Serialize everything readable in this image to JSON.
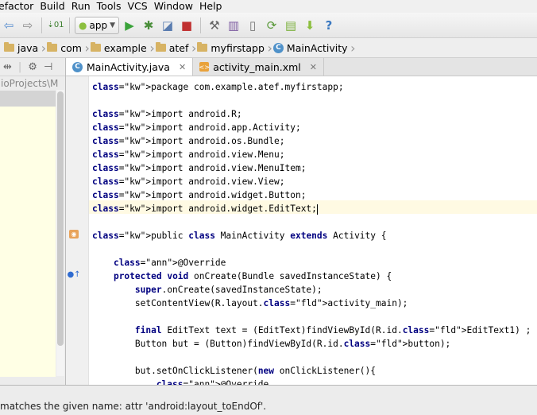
{
  "menu": [
    "efactor",
    "Build",
    "Run",
    "Tools",
    "VCS",
    "Window",
    "Help"
  ],
  "toolbar": {
    "run_config": "app",
    "icons": [
      "undo-icon",
      "redo-icon",
      "sort-icon",
      "android-icon",
      "run-icon",
      "debug-icon",
      "attach-debugger-icon",
      "stop-icon",
      "project-structure-icon",
      "sdk-settings-icon",
      "avd-manager-icon",
      "sync-gradle-icon",
      "android-device-monitor-icon",
      "sdk-manager-icon",
      "help-icon"
    ]
  },
  "breadcrumbs": [
    "java",
    "com",
    "example",
    "atef",
    "myfirstapp",
    "MainActivity"
  ],
  "sidebar": {
    "path_text": "ioProjects\\M"
  },
  "tabs": [
    {
      "label": "MainActivity.java",
      "active": true
    },
    {
      "label": "activity_main.xml",
      "active": false
    }
  ],
  "code_lines": [
    "package com.example.atef.myfirstapp;",
    "",
    "import android.R;",
    "import android.app.Activity;",
    "import android.os.Bundle;",
    "import android.view.Menu;",
    "import android.view.MenuItem;",
    "import android.view.View;",
    "import android.widget.Button;",
    "import android.widget.EditText;",
    "",
    "public class MainActivity extends Activity {",
    "",
    "    @Override",
    "    protected void onCreate(Bundle savedInstanceState) {",
    "        super.onCreate(savedInstanceState);",
    "        setContentView(R.layout.activity_main);",
    "",
    "        final EditText text = (EditText)findViewById(R.id.EditText1) ;",
    "        Button but = (Button)findViewById(R.id.button);",
    "",
    "        but.setOnClickListener(new onClickListener(){",
    "            @Override"
  ],
  "status": {
    "message": "matches the given name: attr 'android:layout_toEndOf'."
  },
  "colors": {
    "current_line": "#fffae3",
    "keyword": "#000080",
    "annotation": "#808000",
    "field": "#660e7a"
  }
}
